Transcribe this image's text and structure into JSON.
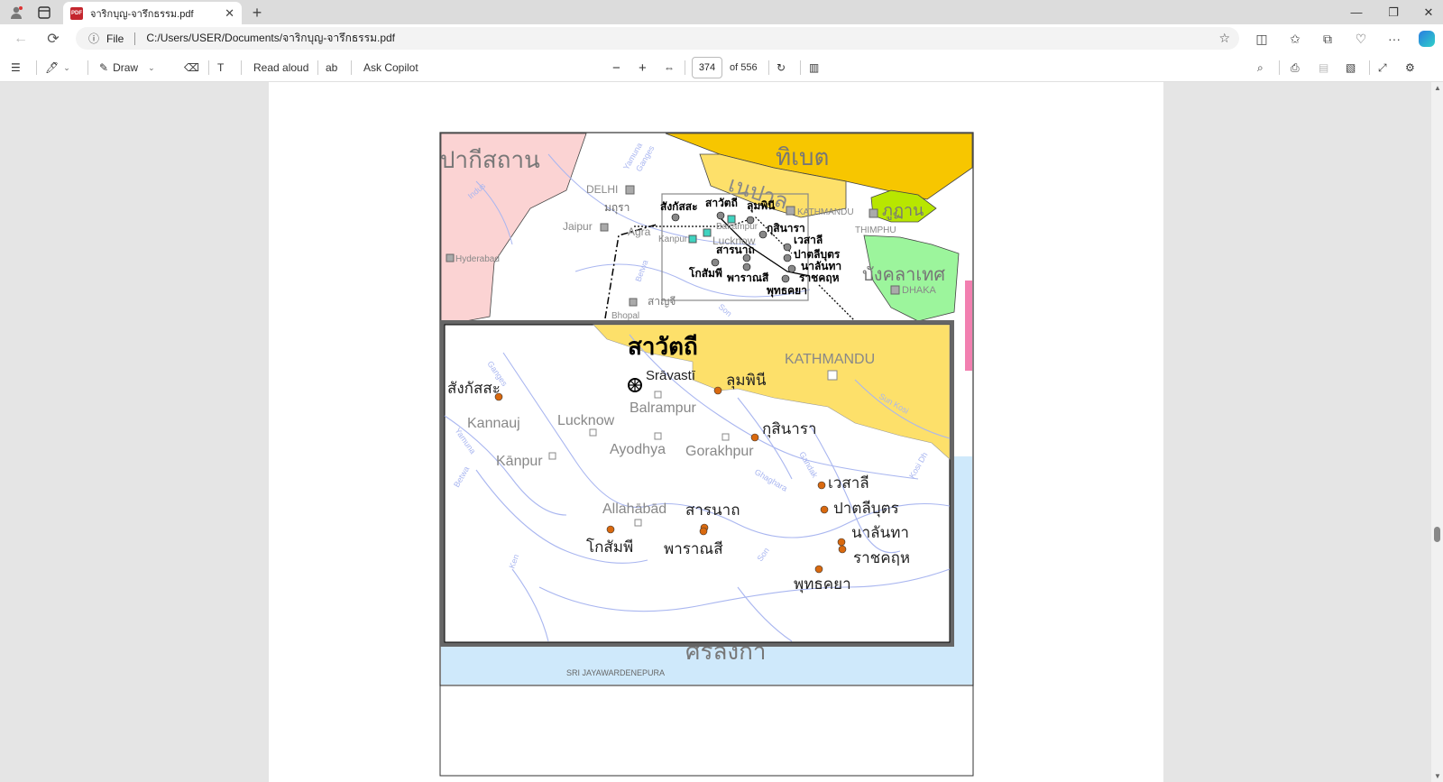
{
  "browser": {
    "tab_title": "จาริกบุญ-จารึกธรรม.pdf",
    "file_label": "File",
    "url": "C:/Users/USER/Documents/จาริกบุญ-จารึกธรรม.pdf"
  },
  "pdf_toolbar": {
    "draw_label": "Draw",
    "read_aloud_label": "Read aloud",
    "ask_copilot_label": "Ask Copilot",
    "current_page": "374",
    "page_total": "of 556"
  },
  "map_top": {
    "country_pakistan": "ปากีสถาน",
    "country_tibet": "ทิเบต",
    "country_nepal": "เนปาล",
    "country_bhutan": "ภูฏาน",
    "country_bangladesh": "บังคลาเทศ",
    "country_srilanka": "ศรีลังกา",
    "city_delhi": "DELHI",
    "city_jaipur": "Jaipur",
    "city_agra": "Agra",
    "city_hyderabad": "Hyderabad",
    "city_kathmandu": "KATHMANDU",
    "city_thimphu": "THIMPHU",
    "city_dhaka": "DHAKA",
    "city_bhopal": "Bhopal",
    "city_lucknow": "Lucknow",
    "city_kanpur": "Kanpur",
    "city_balrampur": "Balrampur",
    "city_srijaya": "SRI JAYAWARDENEPURA",
    "place_mathura": "มถุรา",
    "place_sanchi": "สาญจี",
    "place_sankassa": "สังกัสสะ",
    "place_savatthi": "สาวัตถี",
    "place_lumbini": "ลุมพินี",
    "place_kusinara": "กุสินารา",
    "place_vesali": "เวสาลี",
    "place_pataliputra": "ปาตลีบุตร",
    "place_nalanda": "นาลันทา",
    "place_rajagaha": "ราชคฤห",
    "place_bodhgaya": "พุทธคยา",
    "place_sarnath": "สารนาถ",
    "place_varanasi": "พาราณสี",
    "place_kosambi": "โกสัมพี",
    "river_yamuna": "Yamuna",
    "river_ganges": "Ganges",
    "river_indus": "Indus",
    "river_betwa": "Betwa",
    "river_son": "Son"
  },
  "map_inset": {
    "title": "สาวัตถี",
    "sravasti": "Srāvastī",
    "kathmandu": "KATHMANDU",
    "balrampur": "Balrampur",
    "lucknow": "Lucknow",
    "kannauj": "Kannauj",
    "ayodhya": "Ayodhya",
    "gorakhpur": "Gorakhpur",
    "kanpur": "Kānpur",
    "allahabad": "Allahābād",
    "sankassa": "สังกัสสะ",
    "lumbini": "ลุมพินี",
    "kusinara": "กุสินารา",
    "vesali": "เวสาลี",
    "pataliputra": "ปาตลีบุตร",
    "nalanda": "นาลันทา",
    "rajagaha": "ราชคฤห",
    "bodhgaya": "พุทธคยา",
    "sarnath": "สารนาถ",
    "varanasi": "พาราณสี",
    "kosambi": "โกสัมพี",
    "river_ganges": "Ganges",
    "river_yamuna": "Yamuna",
    "river_betwa": "Betwa",
    "river_ken": "Ken",
    "river_son": "Son",
    "river_gandak": "Gandak",
    "river_ghaghara": "Ghaghara",
    "river_kosi": "Kosi Dh",
    "river_sun_kosi": "Sun Kosi"
  },
  "colors": {
    "nepal": "#fde06a",
    "tibet": "#f7c600",
    "pakistan": "#fbd3d3",
    "bhutan": "#b8e600",
    "bangladesh": "#9cf59c",
    "river": "#a9b6f0",
    "water": "#cfe9fb",
    "site_dot": "#d9690f"
  }
}
